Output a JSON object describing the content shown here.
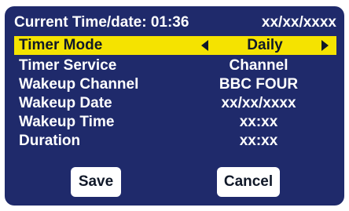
{
  "header": {
    "title": "Current Time/date: 01:36",
    "date": "xx/xx/xxxx"
  },
  "rows": [
    {
      "label": "Timer Mode",
      "value": "Daily",
      "selected": true
    },
    {
      "label": "Timer Service",
      "value": "Channel"
    },
    {
      "label": "Wakeup Channel",
      "value": "BBC FOUR"
    },
    {
      "label": "Wakeup Date",
      "value": "xx/xx/xxxx"
    },
    {
      "label": "Wakeup Time",
      "value": "xx:xx"
    },
    {
      "label": "Duration",
      "value": "xx:xx"
    }
  ],
  "buttons": {
    "save": "Save",
    "cancel": "Cancel"
  },
  "icons": {
    "left": "left-arrow-icon",
    "right": "right-arrow-icon"
  },
  "colors": {
    "panel_bg": "#1f2a6b",
    "highlight": "#f5e300",
    "text": "#ffffff"
  }
}
